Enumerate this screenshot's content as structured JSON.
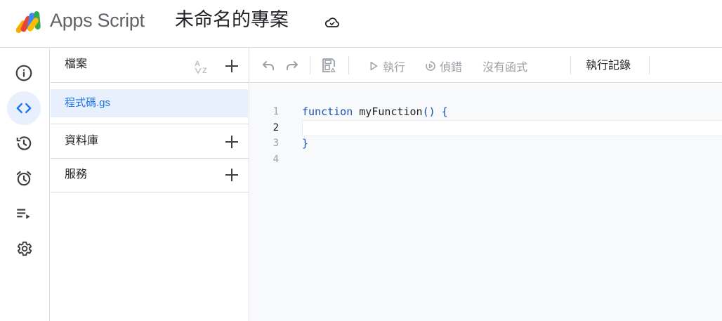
{
  "header": {
    "app_name": "Apps Script",
    "project_title": "未命名的專案",
    "icons": {
      "logo": "apps-script-logo",
      "cloud": "cloud-saved-icon"
    }
  },
  "rail": {
    "items": [
      {
        "name": "overview",
        "icon": "info-icon",
        "active": false
      },
      {
        "name": "editor",
        "icon": "code-icon",
        "active": true
      },
      {
        "name": "versions",
        "icon": "history-icon",
        "active": false
      },
      {
        "name": "triggers",
        "icon": "alarm-icon",
        "active": false
      },
      {
        "name": "executions",
        "icon": "executions-list-icon",
        "active": false
      },
      {
        "name": "settings",
        "icon": "gear-icon",
        "active": false
      }
    ]
  },
  "files_panel": {
    "files_label": "檔案",
    "files": [
      {
        "name": "程式碼.gs",
        "selected": true
      }
    ],
    "libraries_label": "資料庫",
    "services_label": "服務"
  },
  "toolbar": {
    "run_label": "執行",
    "debug_label": "偵錯",
    "function_select_label": "沒有函式",
    "execution_log_label": "執行記錄"
  },
  "editor": {
    "current_line": 2,
    "lines": [
      {
        "number": "1",
        "keyword": "function",
        "rest": " myFunction",
        "punct": "() {"
      },
      {
        "number": "2",
        "text": ""
      },
      {
        "number": "3",
        "text": "}"
      },
      {
        "number": "4",
        "text": ""
      }
    ]
  },
  "colors": {
    "accent": "#1a73e8",
    "active_bg": "#e8f0fe",
    "keyword": "#1a4fb5",
    "editor_bg": "#f8f9fa",
    "border": "#dadce0"
  }
}
